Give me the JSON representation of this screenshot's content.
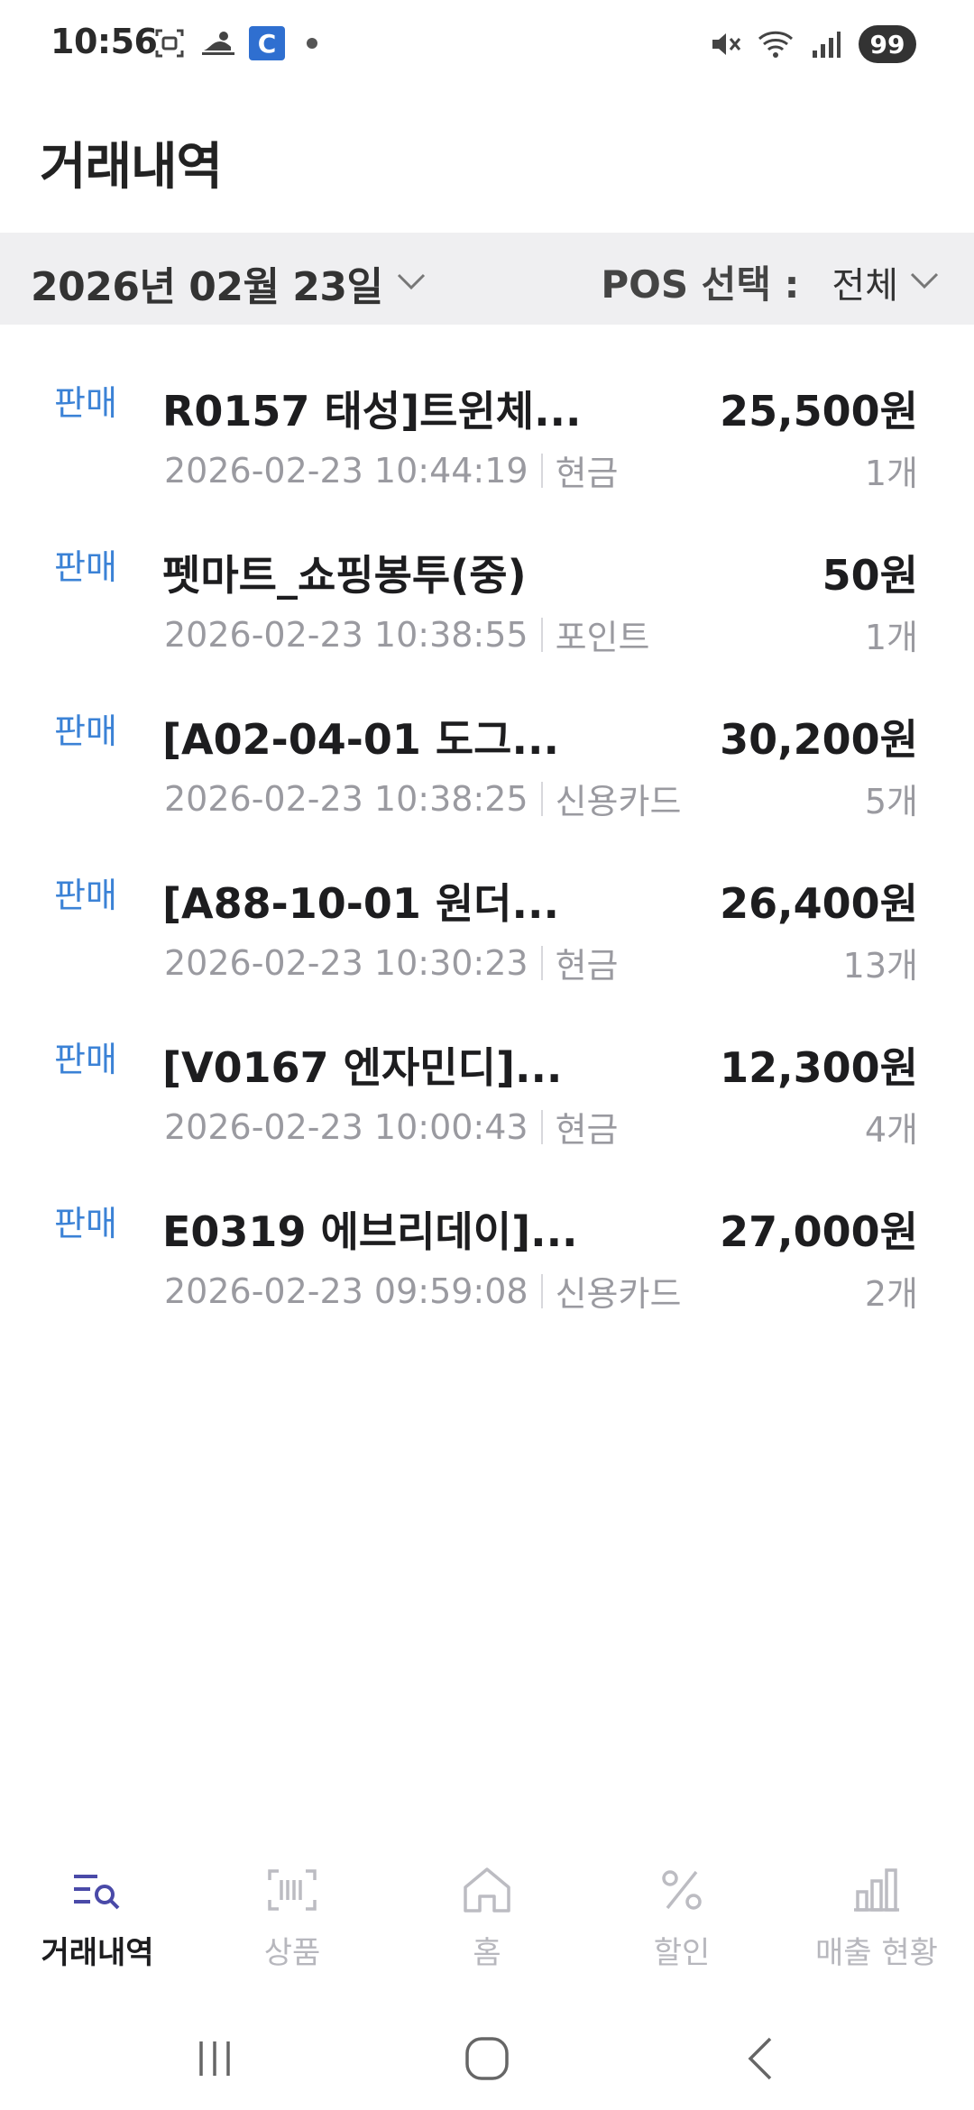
{
  "status_bar": {
    "time": "10:56",
    "c_badge": "C",
    "battery": "99"
  },
  "page": {
    "title": "거래내역"
  },
  "filter": {
    "date": "2026년 02월 23일",
    "pos_label": "POS 선택 :",
    "pos_value": "전체"
  },
  "transactions": [
    {
      "type": "판매",
      "name": "R0157 태성]트윈체...",
      "amount": "25,500원",
      "datetime": "2026-02-23 10:44:19",
      "payment": "현금",
      "qty": "1개"
    },
    {
      "type": "판매",
      "name": "펫마트_쇼핑봉투(중)",
      "amount": "50원",
      "datetime": "2026-02-23 10:38:55",
      "payment": "포인트",
      "qty": "1개"
    },
    {
      "type": "판매",
      "name": "[A02-04-01 도그...",
      "amount": "30,200원",
      "datetime": "2026-02-23 10:38:25",
      "payment": "신용카드",
      "qty": "5개"
    },
    {
      "type": "판매",
      "name": "[A88-10-01 원더...",
      "amount": "26,400원",
      "datetime": "2026-02-23 10:30:23",
      "payment": "현금",
      "qty": "13개"
    },
    {
      "type": "판매",
      "name": "[V0167 엔자민디]...",
      "amount": "12,300원",
      "datetime": "2026-02-23 10:00:43",
      "payment": "현금",
      "qty": "4개"
    },
    {
      "type": "판매",
      "name": "E0319 에브리데이]...",
      "amount": "27,000원",
      "datetime": "2026-02-23 09:59:08",
      "payment": "신용카드",
      "qty": "2개"
    }
  ],
  "bottom_nav": [
    {
      "label": "거래내역",
      "icon": "transaction-search-icon",
      "active": true
    },
    {
      "label": "상품",
      "icon": "barcode-icon",
      "active": false
    },
    {
      "label": "홈",
      "icon": "home-icon",
      "active": false
    },
    {
      "label": "할인",
      "icon": "percent-icon",
      "active": false
    },
    {
      "label": "매출 현황",
      "icon": "bar-chart-icon",
      "active": false
    }
  ],
  "colors": {
    "accent": "#3b82d6",
    "filter_bg": "#efeff1",
    "muted": "#9a9aa0",
    "nav_active_icon": "#4a4aa8"
  }
}
